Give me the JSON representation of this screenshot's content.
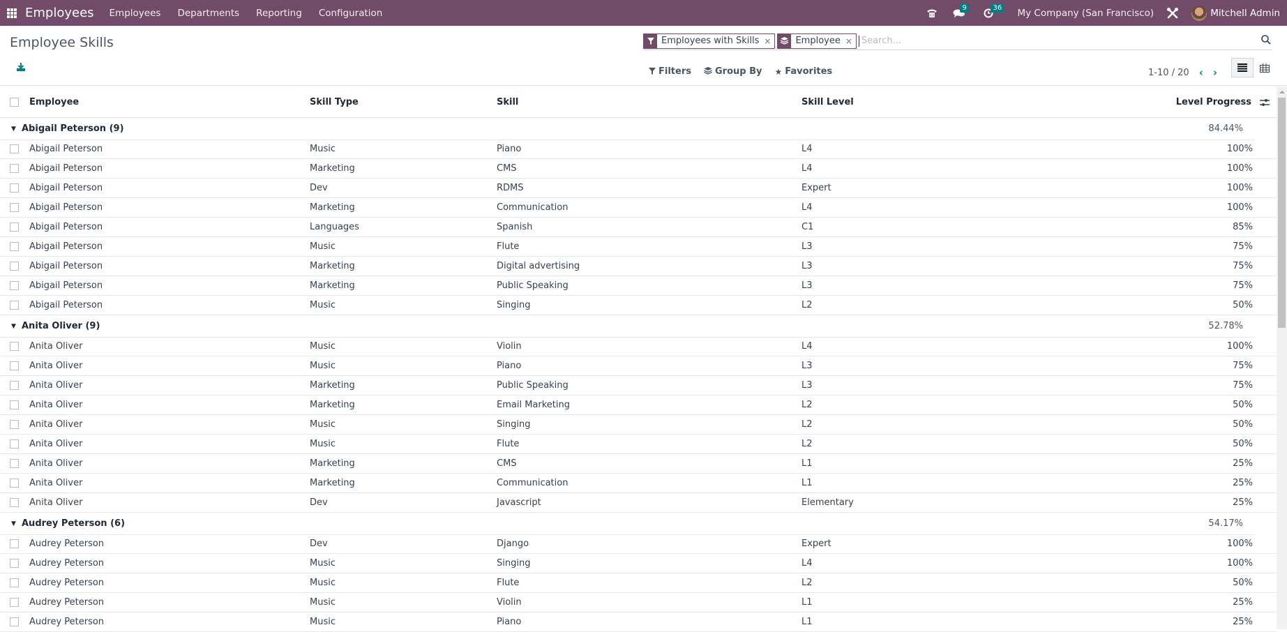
{
  "navbar": {
    "app_name": "Employees",
    "menu": [
      "Employees",
      "Departments",
      "Reporting",
      "Configuration"
    ],
    "messages_count": "9",
    "activities_count": "36",
    "company": "My Company (San Francisco)",
    "user": "Mitchell Admin"
  },
  "control_panel": {
    "title": "Employee Skills",
    "facets": [
      {
        "icon": "filter-icon",
        "label": "Employees with Skills"
      },
      {
        "icon": "layers-icon",
        "label": "Employee"
      }
    ],
    "search_placeholder": "Search...",
    "filters_label": "Filters",
    "groupby_label": "Group By",
    "favorites_label": "Favorites",
    "pager": "1-10 / 20"
  },
  "table": {
    "columns": {
      "employee": "Employee",
      "skill_type": "Skill Type",
      "skill": "Skill",
      "skill_level": "Skill Level",
      "level_progress": "Level Progress"
    },
    "groups": [
      {
        "label": "Abigail Peterson (9)",
        "progress": "84.44%",
        "rows": [
          {
            "employee": "Abigail Peterson",
            "type": "Music",
            "skill": "Piano",
            "level": "L4",
            "progress": "100%"
          },
          {
            "employee": "Abigail Peterson",
            "type": "Marketing",
            "skill": "CMS",
            "level": "L4",
            "progress": "100%"
          },
          {
            "employee": "Abigail Peterson",
            "type": "Dev",
            "skill": "RDMS",
            "level": "Expert",
            "progress": "100%"
          },
          {
            "employee": "Abigail Peterson",
            "type": "Marketing",
            "skill": "Communication",
            "level": "L4",
            "progress": "100%"
          },
          {
            "employee": "Abigail Peterson",
            "type": "Languages",
            "skill": "Spanish",
            "level": "C1",
            "progress": "85%"
          },
          {
            "employee": "Abigail Peterson",
            "type": "Music",
            "skill": "Flute",
            "level": "L3",
            "progress": "75%"
          },
          {
            "employee": "Abigail Peterson",
            "type": "Marketing",
            "skill": "Digital advertising",
            "level": "L3",
            "progress": "75%"
          },
          {
            "employee": "Abigail Peterson",
            "type": "Marketing",
            "skill": "Public Speaking",
            "level": "L3",
            "progress": "75%"
          },
          {
            "employee": "Abigail Peterson",
            "type": "Music",
            "skill": "Singing",
            "level": "L2",
            "progress": "50%"
          }
        ]
      },
      {
        "label": "Anita Oliver (9)",
        "progress": "52.78%",
        "rows": [
          {
            "employee": "Anita Oliver",
            "type": "Music",
            "skill": "Violin",
            "level": "L4",
            "progress": "100%"
          },
          {
            "employee": "Anita Oliver",
            "type": "Music",
            "skill": "Piano",
            "level": "L3",
            "progress": "75%"
          },
          {
            "employee": "Anita Oliver",
            "type": "Marketing",
            "skill": "Public Speaking",
            "level": "L3",
            "progress": "75%"
          },
          {
            "employee": "Anita Oliver",
            "type": "Marketing",
            "skill": "Email Marketing",
            "level": "L2",
            "progress": "50%"
          },
          {
            "employee": "Anita Oliver",
            "type": "Music",
            "skill": "Singing",
            "level": "L2",
            "progress": "50%"
          },
          {
            "employee": "Anita Oliver",
            "type": "Music",
            "skill": "Flute",
            "level": "L2",
            "progress": "50%"
          },
          {
            "employee": "Anita Oliver",
            "type": "Marketing",
            "skill": "CMS",
            "level": "L1",
            "progress": "25%"
          },
          {
            "employee": "Anita Oliver",
            "type": "Marketing",
            "skill": "Communication",
            "level": "L1",
            "progress": "25%"
          },
          {
            "employee": "Anita Oliver",
            "type": "Dev",
            "skill": "Javascript",
            "level": "Elementary",
            "progress": "25%"
          }
        ]
      },
      {
        "label": "Audrey Peterson (6)",
        "progress": "54.17%",
        "rows": [
          {
            "employee": "Audrey Peterson",
            "type": "Dev",
            "skill": "Django",
            "level": "Expert",
            "progress": "100%"
          },
          {
            "employee": "Audrey Peterson",
            "type": "Music",
            "skill": "Singing",
            "level": "L4",
            "progress": "100%"
          },
          {
            "employee": "Audrey Peterson",
            "type": "Music",
            "skill": "Flute",
            "level": "L2",
            "progress": "50%"
          },
          {
            "employee": "Audrey Peterson",
            "type": "Music",
            "skill": "Violin",
            "level": "L1",
            "progress": "25%"
          },
          {
            "employee": "Audrey Peterson",
            "type": "Music",
            "skill": "Piano",
            "level": "L1",
            "progress": "25%"
          }
        ]
      }
    ]
  }
}
